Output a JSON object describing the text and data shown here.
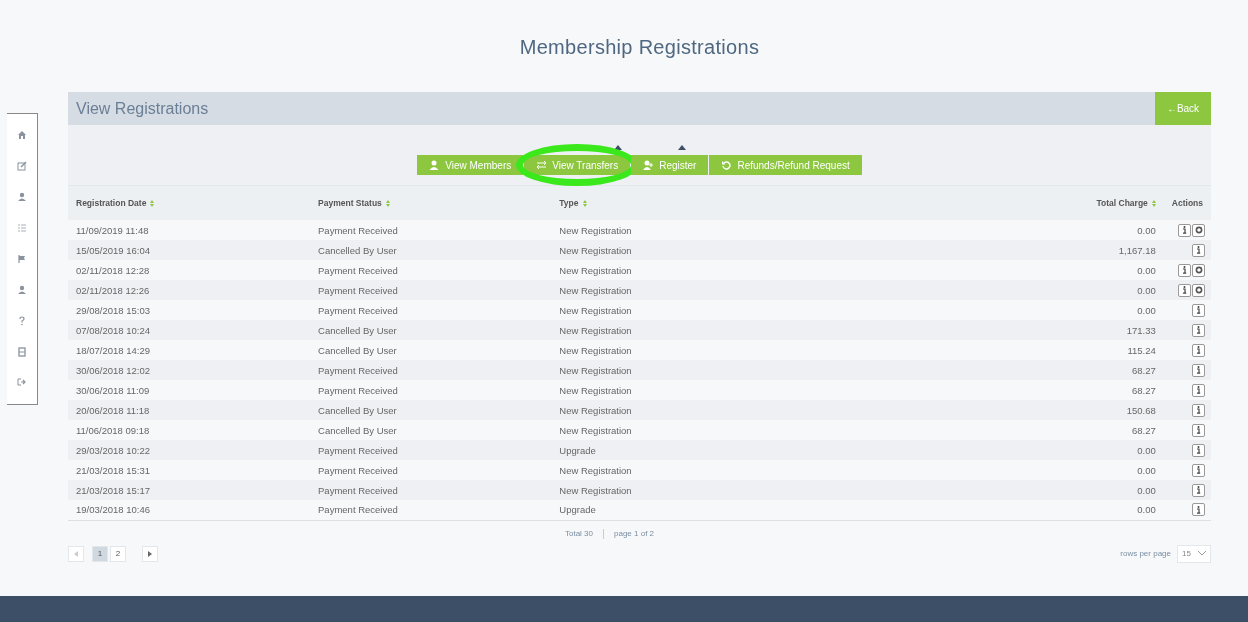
{
  "page_title": "Membership Registrations",
  "panel": {
    "title": "View Registrations",
    "back_button": "←Back"
  },
  "toolbar": {
    "buttons": [
      {
        "label": "View Members",
        "highlighted": false
      },
      {
        "label": "View Transfers",
        "highlighted": true
      },
      {
        "label": "Register",
        "highlighted": false
      },
      {
        "label": "Refunds/Refund Request",
        "highlighted": false
      }
    ]
  },
  "table": {
    "columns": [
      {
        "label": "Registration Date",
        "sortable": true
      },
      {
        "label": "Payment Status",
        "sortable": true
      },
      {
        "label": "Type",
        "sortable": true
      },
      {
        "label": "Total Charge",
        "sortable": true
      },
      {
        "label": "Actions",
        "sortable": false
      }
    ],
    "rows": [
      {
        "date": "11/09/2019 11:48",
        "status": "Payment Received",
        "type": "New Registration",
        "charge": "0.00",
        "settings_action": true
      },
      {
        "date": "15/05/2019 16:04",
        "status": "Cancelled By User",
        "type": "New Registration",
        "charge": "1,167.18",
        "settings_action": false
      },
      {
        "date": "02/11/2018 12:28",
        "status": "Payment Received",
        "type": "New Registration",
        "charge": "0.00",
        "settings_action": true
      },
      {
        "date": "02/11/2018 12:26",
        "status": "Payment Received",
        "type": "New Registration",
        "charge": "0.00",
        "settings_action": true
      },
      {
        "date": "29/08/2018 15:03",
        "status": "Payment Received",
        "type": "New Registration",
        "charge": "0.00",
        "settings_action": false
      },
      {
        "date": "07/08/2018 10:24",
        "status": "Cancelled By User",
        "type": "New Registration",
        "charge": "171.33",
        "settings_action": false
      },
      {
        "date": "18/07/2018 14:29",
        "status": "Cancelled By User",
        "type": "New Registration",
        "charge": "115.24",
        "settings_action": false
      },
      {
        "date": "30/06/2018 12:02",
        "status": "Payment Received",
        "type": "New Registration",
        "charge": "68.27",
        "settings_action": false
      },
      {
        "date": "30/06/2018 11:09",
        "status": "Payment Received",
        "type": "New Registration",
        "charge": "68.27",
        "settings_action": false
      },
      {
        "date": "20/06/2018 11:18",
        "status": "Cancelled By User",
        "type": "New Registration",
        "charge": "150.68",
        "settings_action": false
      },
      {
        "date": "11/06/2018 09:18",
        "status": "Cancelled By User",
        "type": "New Registration",
        "charge": "68.27",
        "settings_action": false
      },
      {
        "date": "29/03/2018 10:22",
        "status": "Payment Received",
        "type": "Upgrade",
        "charge": "0.00",
        "settings_action": false
      },
      {
        "date": "21/03/2018 15:31",
        "status": "Payment Received",
        "type": "New Registration",
        "charge": "0.00",
        "settings_action": false
      },
      {
        "date": "21/03/2018 15:17",
        "status": "Payment Received",
        "type": "New Registration",
        "charge": "0.00",
        "settings_action": false
      },
      {
        "date": "19/03/2018 10:46",
        "status": "Payment Received",
        "type": "Upgrade",
        "charge": "0.00",
        "settings_action": false
      }
    ]
  },
  "summary": {
    "total": "Total 30",
    "page_info": "page 1 of 2"
  },
  "pagination": {
    "pages": [
      {
        "label": "1",
        "selected": true
      },
      {
        "label": "2",
        "selected": false
      }
    ]
  },
  "rows_per_page": {
    "label": "rows per page",
    "value": "15"
  }
}
